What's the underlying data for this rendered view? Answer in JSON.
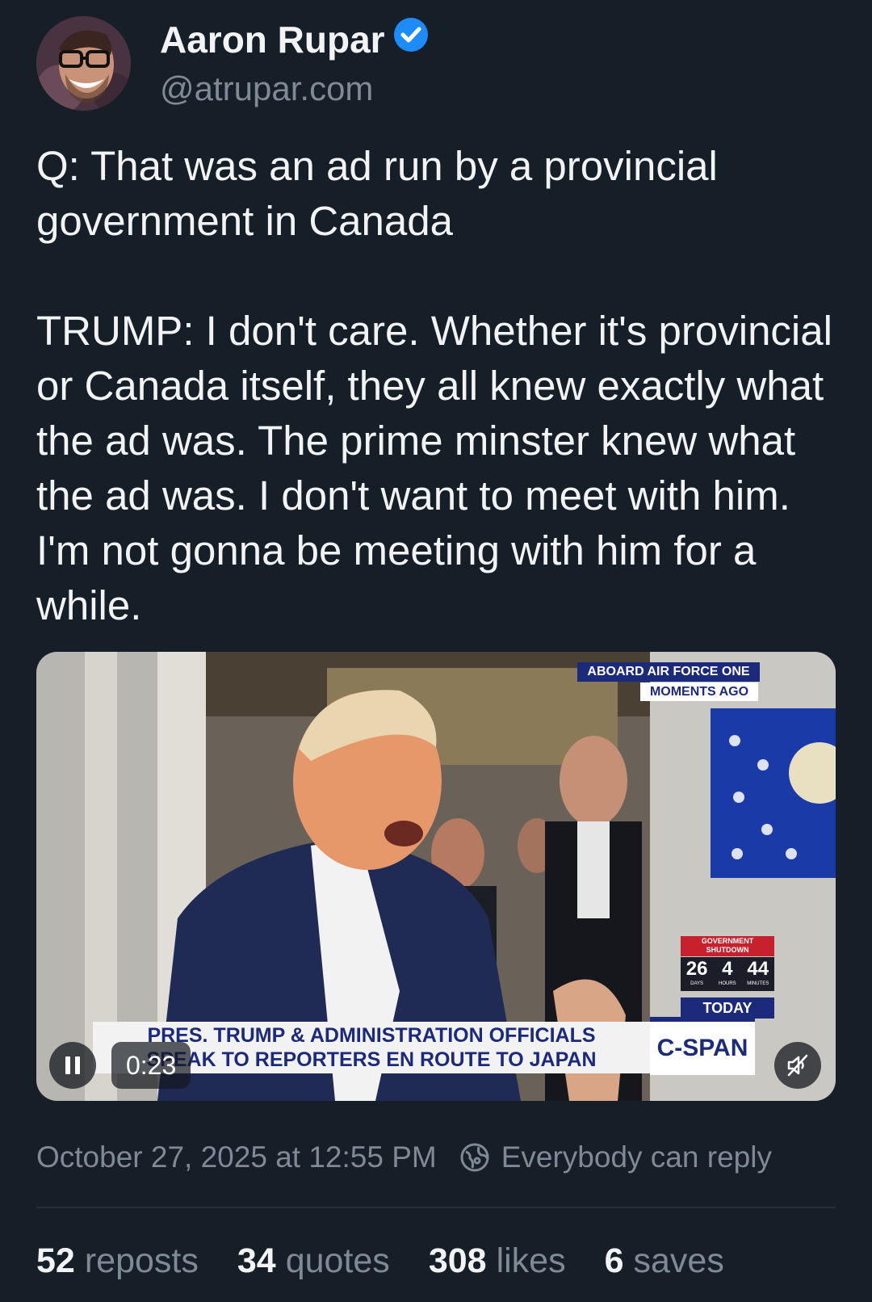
{
  "author": {
    "name": "Aaron Rupar",
    "handle": "@atrupar.com",
    "avatar_icon": "avatar-photo",
    "verified_icon": "verified-badge-icon",
    "verified_color": "#1d8cf8"
  },
  "post": {
    "text": "Q: That was an ad run by a provincial government in Canada\n\nTRUMP: I don't care. Whether it's provincial or Canada itself, they all knew exactly what the ad was. The prime minster knew what the ad was. I don't want to meet with him. I'm not gonna be meeting with him for a while."
  },
  "video": {
    "elapsed": "0:23",
    "state": "playing",
    "muted": true,
    "overlay": {
      "top_banner_1": "ABOARD AIR FORCE ONE",
      "top_banner_2": "MOMENTS AGO",
      "shutdown_label_1": "GOVERNMENT",
      "shutdown_label_2": "SHUTDOWN",
      "shutdown_days": "26",
      "shutdown_hours": "4",
      "shutdown_minutes": "44",
      "shutdown_units": [
        "DAYS",
        "HOURS",
        "MINUTES"
      ],
      "today_label": "TODAY",
      "network": "C-SPAN",
      "lower_third_1": "PRES. TRUMP & ADMINISTRATION OFFICIALS",
      "lower_third_2": "SPEAK TO REPORTERS EN ROUTE TO JAPAN"
    }
  },
  "meta": {
    "timestamp": "October 27, 2025 at 12:55 PM",
    "reply_setting": "Everybody can reply"
  },
  "stats": {
    "reposts_count": "52",
    "reposts_label": "reposts",
    "quotes_count": "34",
    "quotes_label": "quotes",
    "likes_count": "308",
    "likes_label": "likes",
    "saves_count": "6",
    "saves_label": "saves"
  }
}
